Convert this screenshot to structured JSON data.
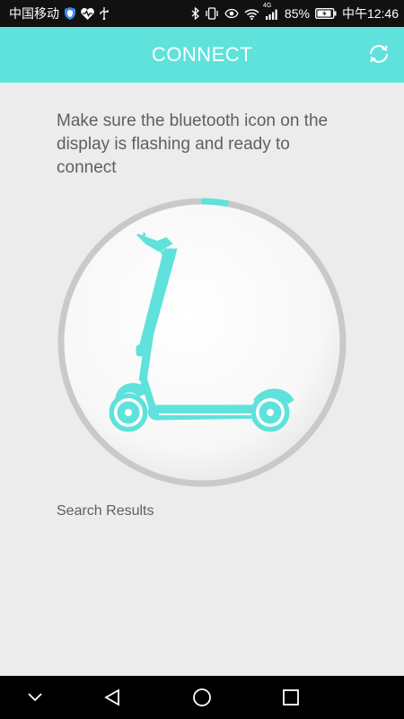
{
  "status_bar": {
    "carrier": "中国移动",
    "network": "4G",
    "battery": "85%",
    "time": "中午12:46"
  },
  "header": {
    "title": "CONNECT"
  },
  "instructions": {
    "text": "Make sure the bluetooth icon on the display is flashing and ready to connect"
  },
  "scanner": {
    "progress_fraction": 0.03,
    "accent_color": "#5ee2db"
  },
  "search": {
    "label": "Search Results"
  },
  "colors": {
    "header_bg": "#5ee2db",
    "page_bg": "#ececec",
    "ring": "#c9c9c9"
  }
}
